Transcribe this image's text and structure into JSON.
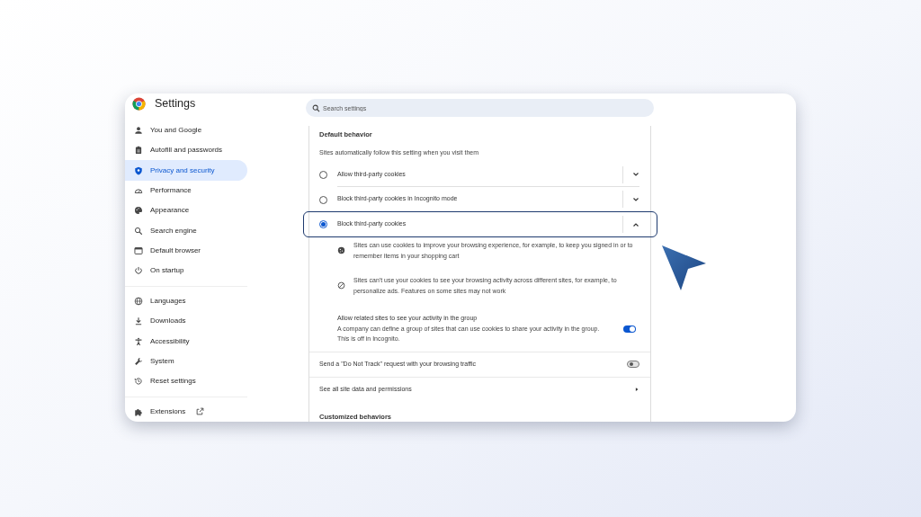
{
  "window": {
    "title": "Settings"
  },
  "search": {
    "placeholder": "Search settings"
  },
  "sidebar": {
    "groups": [
      [
        {
          "label": "You and Google",
          "selected": false
        },
        {
          "label": "Autofill and passwords",
          "selected": false
        },
        {
          "label": "Privacy and security",
          "selected": true
        },
        {
          "label": "Performance",
          "selected": false
        },
        {
          "label": "Appearance",
          "selected": false
        },
        {
          "label": "Search engine",
          "selected": false
        },
        {
          "label": "Default browser",
          "selected": false
        },
        {
          "label": "On startup",
          "selected": false
        }
      ],
      [
        {
          "label": "Languages",
          "selected": false
        },
        {
          "label": "Downloads",
          "selected": false
        },
        {
          "label": "Accessibility",
          "selected": false
        },
        {
          "label": "System",
          "selected": false
        },
        {
          "label": "Reset settings",
          "selected": false
        }
      ],
      [
        {
          "label": "Extensions",
          "selected": false,
          "external": true
        }
      ]
    ]
  },
  "content": {
    "heading": "Default behavior",
    "description": "Sites automatically follow this setting when you visit them",
    "options": [
      {
        "label": "Allow third-party cookies",
        "selected": false,
        "expanded": false,
        "highlighted": false
      },
      {
        "label": "Block third-party cookies in Incognito mode",
        "selected": false,
        "expanded": false,
        "highlighted": false
      },
      {
        "label": "Block third-party cookies",
        "selected": true,
        "expanded": true,
        "highlighted": true,
        "details": [
          "Sites can use cookies to improve your browsing experience, for example, to keep you signed in or to remember items in your shopping cart",
          "Sites can't use your cookies to see your browsing activity across different sites, for example, to personalize ads. Features on some sites may not work"
        ],
        "toggle": {
          "title": "Allow related sites to see your activity in the group",
          "description": "A company can define a group of sites that can use cookies to share your activity in the group. This is off in Incognito.",
          "on": true
        }
      }
    ],
    "rows": [
      {
        "kind": "toggle",
        "label": "Send a \"Do Not Track\" request with your browsing traffic",
        "on": false
      },
      {
        "kind": "link",
        "label": "See all site data and permissions"
      }
    ],
    "next_heading": "Customized behaviors"
  }
}
